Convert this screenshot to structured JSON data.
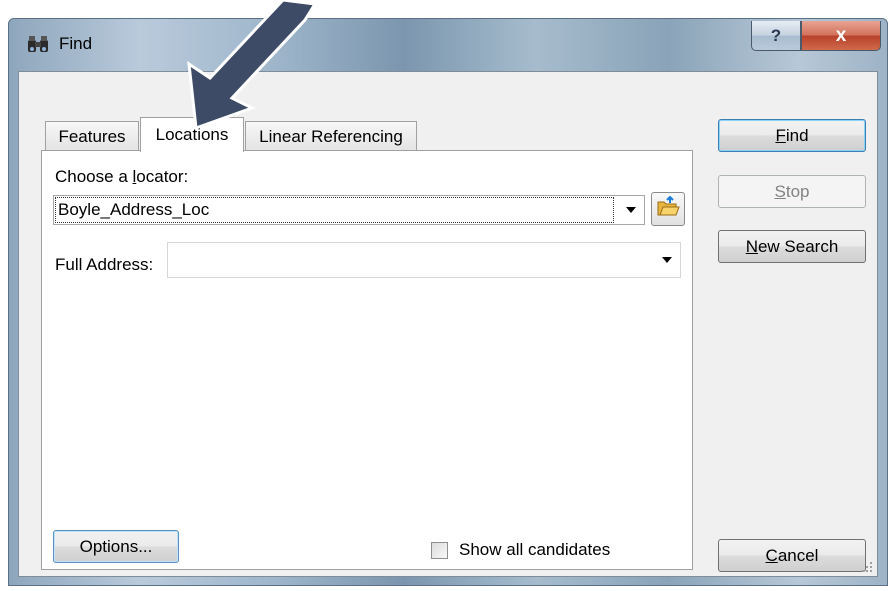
{
  "window": {
    "title": "Find",
    "help_glyph": "?",
    "close_glyph": "x"
  },
  "tabs": [
    {
      "label": "Features",
      "active": false
    },
    {
      "label": "Locations",
      "active": true
    },
    {
      "label": "Linear Referencing",
      "active": false
    }
  ],
  "locator": {
    "label": "Choose a locator:",
    "value": "Boyle_Address_Loc"
  },
  "address": {
    "label": "Full Address:",
    "value": ""
  },
  "options_button": "Options...",
  "show_all_candidates": {
    "label": "Show all candidates",
    "checked": false
  },
  "buttons": {
    "find": "Find",
    "stop": "Stop",
    "new_search": "New Search",
    "cancel": "Cancel"
  },
  "icons": {
    "app": "binoculars-icon",
    "browse": "folder-open-icon",
    "annotation": "pointer-arrow"
  },
  "colors": {
    "annotation_arrow": "#3d4b66",
    "default_button_border": "#3c7fb1"
  }
}
